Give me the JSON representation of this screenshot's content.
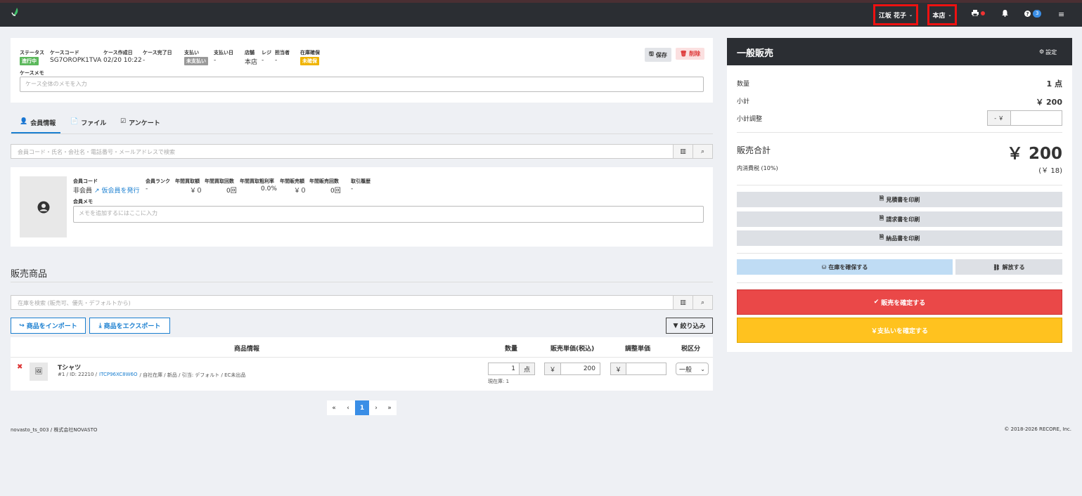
{
  "topbar": {
    "user_name": "江坂 花子",
    "store_name": "本店",
    "help_badge": "3"
  },
  "case": {
    "status_label": "ステータス",
    "status_value": "進行中",
    "code_label": "ケースコード",
    "code_value": "SG7OROPK1TVA",
    "created_label": "ケース作成日",
    "created_value": "02/20 10:22",
    "completed_label": "ケース完了日",
    "completed_value": "-",
    "payment_label": "支払い",
    "payment_value": "未支払い",
    "payment_date_label": "支払い日",
    "payment_date_value": "-",
    "store_label": "店舗",
    "store_value": "本店",
    "register_label": "レジ",
    "register_value": "-",
    "staff_label": "担当者",
    "staff_value": "-",
    "stock_label": "在庫確保",
    "stock_value": "未確保",
    "save_label": "保存",
    "delete_label": "削除",
    "memo_label": "ケースメモ",
    "memo_placeholder": "ケース全体のメモを入力"
  },
  "tabs": [
    "会員情報",
    "ファイル",
    "アンケート"
  ],
  "member_search_placeholder": "会員コード・氏名・会社名・電話番号・メールアドレスで検索",
  "member": {
    "code_label": "会員コード",
    "code_value": "非会員",
    "issue_link": "仮会員を発行",
    "rank_label": "会員ランク",
    "rank_value": "-",
    "buy_amount_label": "年間買取額",
    "buy_amount_value": "￥０",
    "buy_count_label": "年間買取回数",
    "buy_count_value": "0回",
    "margin_label": "年間買取粗利率",
    "margin_value": "0.0%",
    "sales_amount_label": "年間販売額",
    "sales_amount_value": "￥０",
    "sales_count_label": "年間販売回数",
    "sales_count_value": "0回",
    "history_label": "取引履歴",
    "history_value": "-",
    "memo_label": "会員メモ",
    "memo_placeholder": "メモを追加するにはここに入力"
  },
  "products": {
    "section_title": "販売商品",
    "search_placeholder": "在庫を検索 (販売可、優先・デフォルトから)",
    "import_label": "商品をインポート",
    "export_label": "商品をエクスポート",
    "filter_label": "絞り込み",
    "headers": [
      "商品情報",
      "数量",
      "販売単価(税込)",
      "調整単価",
      "税区分"
    ],
    "row": {
      "name": "Tシャツ",
      "meta_prefix": "#1 / ID: 22210 /",
      "sku": "ITCP96XC8W6O",
      "meta_suffix": "/ 自社在庫 / 新品 / 引当: デフォルト / EC未出品",
      "qty": "1",
      "qty_unit": "点",
      "stock_note": "現在庫: 1",
      "yen": "￥",
      "price": "200",
      "adjust_price": "",
      "tax": "一般"
    }
  },
  "pagination": [
    "«",
    "‹",
    "1",
    "›",
    "»"
  ],
  "footer": {
    "left": "novasto_ts_003 / 株式会社NOVASTO",
    "right": "© 2018-2026 RECORE, Inc."
  },
  "summary": {
    "title": "一般販売",
    "settings_label": "設定",
    "qty_label": "数量",
    "qty_value": "1 点",
    "subtotal_label": "小計",
    "subtotal_value": "￥ 200",
    "adjust_label": "小計調整",
    "adjust_prefix": "- ￥",
    "adjust_value": "",
    "total_label": "販売合計",
    "total_value": "￥ 200",
    "tax_label": "内消費税 (10%)",
    "tax_value": "(￥ 18)",
    "print_estimate": "見積書を印刷",
    "print_invoice": "請求書を印刷",
    "print_delivery": "納品書を印刷",
    "reserve_label": "在庫を確保する",
    "release_label": "解放する",
    "confirm_sale": "販売を確定する",
    "confirm_payment": "￥支払いを確定する"
  },
  "colors": {
    "topbar": "#2b2e33",
    "status_green": "#5cb85c",
    "stock_yellow": "#f0b400",
    "confirm_red": "#ea4848",
    "payment_yellow": "#ffc21f",
    "reserve_blue": "#bfdcf4"
  }
}
